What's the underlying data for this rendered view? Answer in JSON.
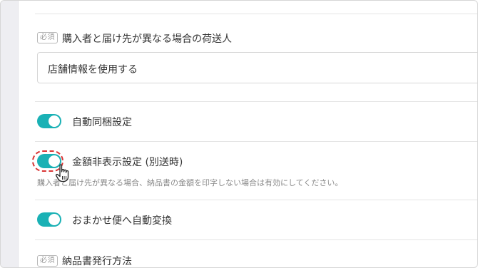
{
  "form": {
    "required_badge": "必須",
    "consignor_label": "購入者と届け先が異なる場合の荷送人",
    "consignor_value": "店舗情報を使用する",
    "auto_bundle_label": "自動同梱設定",
    "hide_amount_label": "金額非表示設定 (別送時)",
    "hide_amount_help": "購入者と届け先が異なる場合、納品書の金額を印字しない場合は有効にしてください。",
    "omakase_label": "おまかせ便へ自動変換",
    "invoice_method_label": "納品書発行方法"
  },
  "toggles": {
    "auto_bundle": true,
    "hide_amount": true,
    "omakase": true
  },
  "colors": {
    "toggle_on": "#1ab1b5",
    "highlight": "#d93434"
  }
}
